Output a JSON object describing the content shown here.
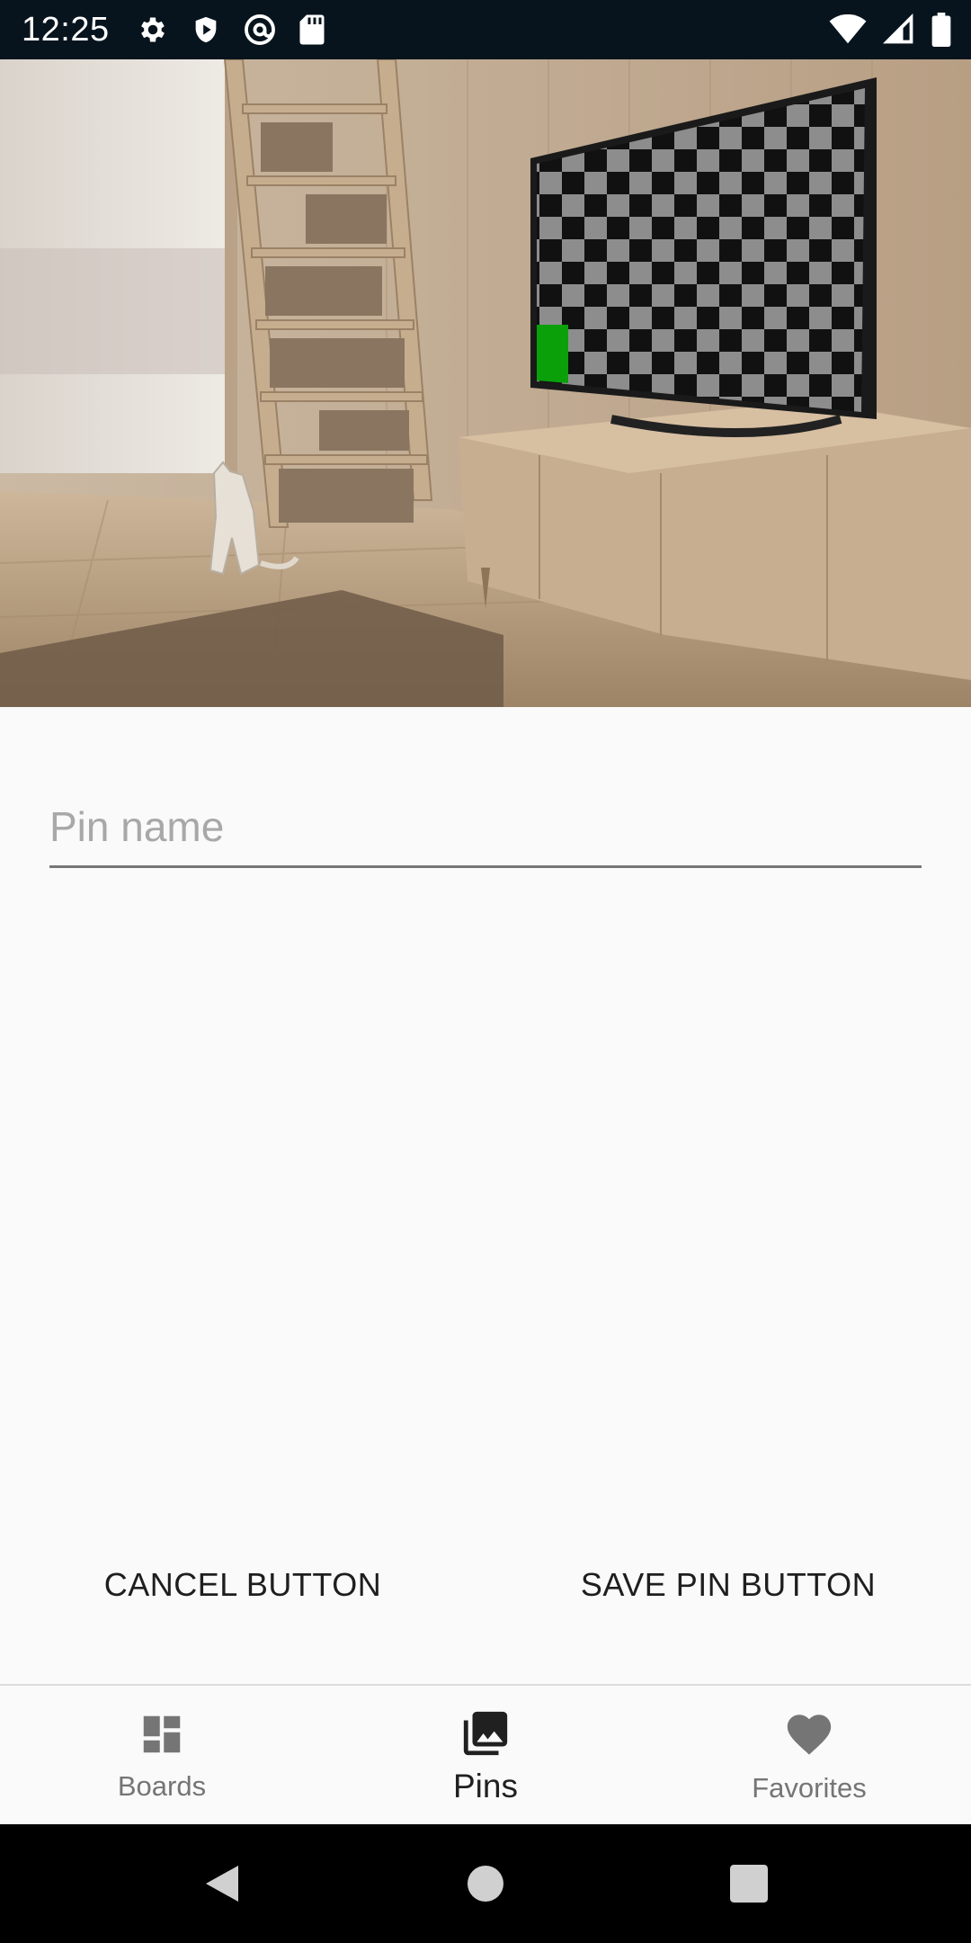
{
  "status_bar": {
    "time": "12:25",
    "left_icons": [
      "settings-icon",
      "shield-icon",
      "at-sign-icon",
      "sd-card-icon"
    ],
    "right_icons": [
      "wifi-icon",
      "cell-signal-icon",
      "battery-icon"
    ]
  },
  "hero": {
    "image": "living-room-tv-cat-photo",
    "accent_colors": {
      "screen_green": "#0aa00a"
    }
  },
  "form": {
    "pin_name_value": "",
    "pin_name_placeholder": "Pin name"
  },
  "actions": {
    "cancel_label": "CANCEL BUTTON",
    "save_label": "SAVE PIN BUTTON"
  },
  "bottom_nav": {
    "items": [
      {
        "label": "Boards",
        "icon": "dashboard-icon",
        "active": false
      },
      {
        "label": "Pins",
        "icon": "photo-library-icon",
        "active": true
      },
      {
        "label": "Favorites",
        "icon": "heart-icon",
        "active": false
      }
    ]
  },
  "system_nav": {
    "buttons": [
      "back-icon",
      "home-icon",
      "recents-icon"
    ]
  }
}
